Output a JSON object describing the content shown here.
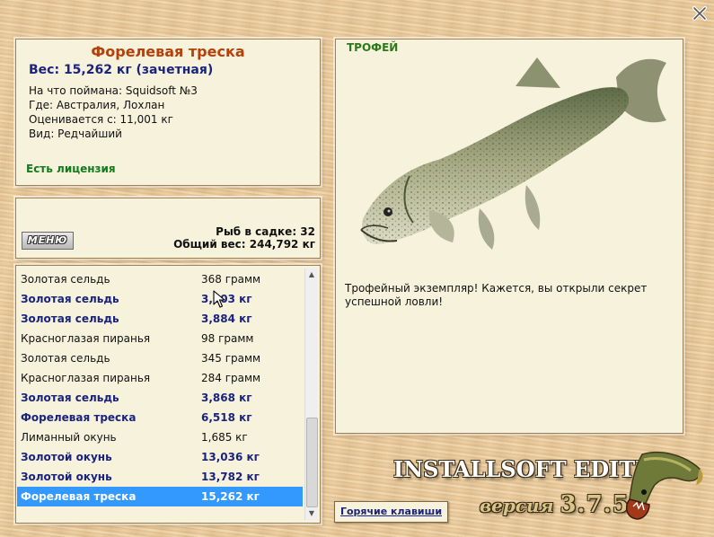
{
  "fish": {
    "name": "Форелевая треска",
    "weight_line": "Вес: 15,262 кг (зачетная)",
    "caught_on": "На что поймана: Squidsoft №3",
    "location": "Где: Австралия, Лохлан",
    "valued_from": "Оценивается с: 11,001 кг",
    "rarity": "Вид: Редчайший",
    "license": "Есть лицензия"
  },
  "stats": {
    "menu_label": "МЕНЮ",
    "fish_in_cage": "Рыб в садке: 32",
    "total_weight": "Общий вес: 244,792 кг"
  },
  "catch_list": [
    {
      "name": "Золотая сельдь",
      "weight": "368 грамм",
      "bold": false
    },
    {
      "name": "Золотая сельдь",
      "weight": "3,603 кг",
      "bold": true
    },
    {
      "name": "Золотая сельдь",
      "weight": "3,884 кг",
      "bold": true
    },
    {
      "name": "Красноглазая пиранья",
      "weight": "98 грамм",
      "bold": false
    },
    {
      "name": "Золотая сельдь",
      "weight": "345 грамм",
      "bold": false
    },
    {
      "name": "Красноглазая пиранья",
      "weight": "284 грамм",
      "bold": false
    },
    {
      "name": "Золотая сельдь",
      "weight": "3,868 кг",
      "bold": true
    },
    {
      "name": "Форелевая треска",
      "weight": "6,518 кг",
      "bold": true
    },
    {
      "name": "Лиманный окунь",
      "weight": "1,685 кг",
      "bold": false
    },
    {
      "name": "Золотой окунь",
      "weight": "13,036 кг",
      "bold": true
    },
    {
      "name": "Золотой окунь",
      "weight": "13,782 кг",
      "bold": true
    },
    {
      "name": "Форелевая треска",
      "weight": "15,262 кг",
      "bold": true,
      "selected": true
    }
  ],
  "trophy": {
    "label": "ТРОФЕЙ",
    "text": "Трофейный экземпляр! Кажется, вы открыли секрет успешной ловли!"
  },
  "footer": {
    "hotkeys": "Горячие клавиши",
    "edition": "INSTALLSOFT EDITION",
    "version_word": "версия",
    "version_number": "3.7.5"
  },
  "colors": {
    "fish_name": "#b5400a",
    "weight_line": "#1a237e",
    "license": "#137a1e",
    "trophy_label": "#2a7a1c",
    "selection": "#3399ff",
    "panel": "#f6f2dc"
  },
  "icons": {
    "close": "close-icon",
    "logo": "pike-logo-icon",
    "cursor": "mouse-cursor-icon",
    "scroll_up": "scroll-up-arrow-icon",
    "scroll_down": "scroll-down-arrow-icon"
  }
}
